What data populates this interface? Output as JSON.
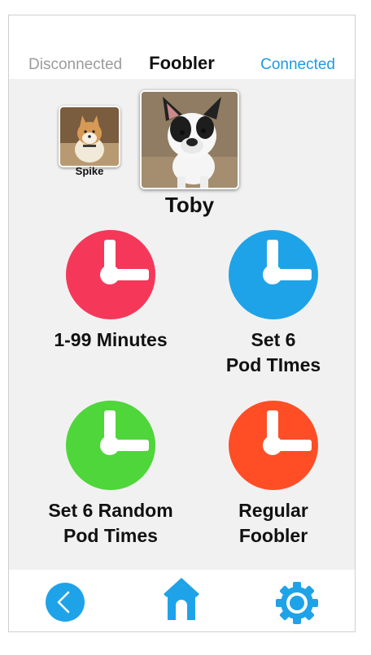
{
  "header": {
    "left_status": "Disconnected",
    "title": "Foobler",
    "right_status": "Connected"
  },
  "pets": [
    {
      "name": "Spike",
      "selected": false
    },
    {
      "name": "Toby",
      "selected": true
    }
  ],
  "modes": [
    {
      "label": "1-99 Minutes",
      "color": "#f5385a",
      "icon": "clock-icon"
    },
    {
      "label": "Set 6\nPod TImes",
      "color": "#1fa3e8",
      "icon": "clock-icon"
    },
    {
      "label": "Set 6 Random\nPod Times",
      "color": "#4fd63a",
      "icon": "clock-icon"
    },
    {
      "label": "Regular\nFoobler",
      "color": "#ff4d26",
      "icon": "clock-icon"
    }
  ],
  "nav": {
    "back_icon": "back-icon",
    "home_icon": "home-icon",
    "settings_icon": "gear-icon",
    "accent": "#1fa3e8"
  }
}
